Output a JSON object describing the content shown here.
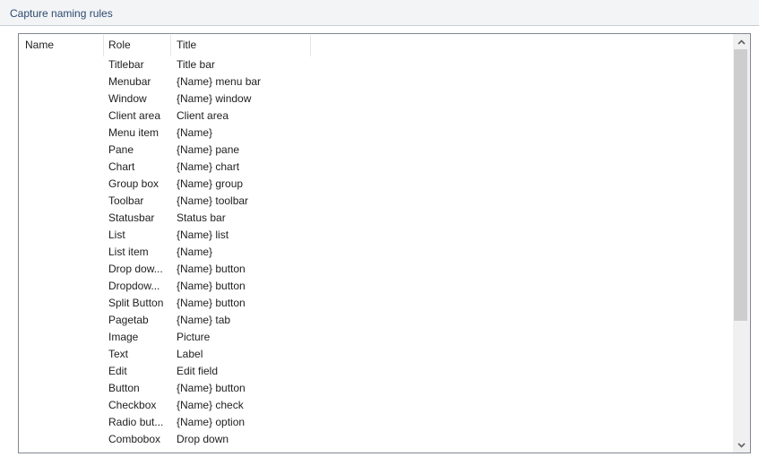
{
  "section": {
    "title": "Capture naming rules"
  },
  "list": {
    "columns": {
      "name": "Name",
      "role": "Role",
      "title": "Title"
    },
    "rows": [
      {
        "name": "",
        "role": "Titlebar",
        "title": "Title bar"
      },
      {
        "name": "",
        "role": "Menubar",
        "title": "{Name} menu bar"
      },
      {
        "name": "",
        "role": "Window",
        "title": "{Name} window"
      },
      {
        "name": "",
        "role": "Client area",
        "title": "Client area"
      },
      {
        "name": "",
        "role": "Menu item",
        "title": "{Name}"
      },
      {
        "name": "",
        "role": "Pane",
        "title": "{Name} pane"
      },
      {
        "name": "",
        "role": "Chart",
        "title": "{Name} chart"
      },
      {
        "name": "",
        "role": "Group box",
        "title": "{Name} group"
      },
      {
        "name": "",
        "role": "Toolbar",
        "title": "{Name} toolbar"
      },
      {
        "name": "",
        "role": "Statusbar",
        "title": "Status bar"
      },
      {
        "name": "",
        "role": "List",
        "title": "{Name} list"
      },
      {
        "name": "",
        "role": "List item",
        "title": "{Name}"
      },
      {
        "name": "",
        "role": "Drop dow...",
        "title": "{Name} button"
      },
      {
        "name": "",
        "role": "Dropdow...",
        "title": "{Name} button"
      },
      {
        "name": "",
        "role": "Split Button",
        "title": "{Name} button"
      },
      {
        "name": "",
        "role": "Pagetab",
        "title": "{Name} tab"
      },
      {
        "name": "",
        "role": "Image",
        "title": "Picture"
      },
      {
        "name": "",
        "role": "Text",
        "title": "Label"
      },
      {
        "name": "",
        "role": "Edit",
        "title": "Edit field"
      },
      {
        "name": "",
        "role": "Button",
        "title": "{Name} button"
      },
      {
        "name": "",
        "role": "Checkbox",
        "title": "{Name} check"
      },
      {
        "name": "",
        "role": "Radio but...",
        "title": "{Name} option"
      },
      {
        "name": "",
        "role": "Combobox",
        "title": "Drop down"
      }
    ]
  },
  "scrollbar": {
    "up_icon": "▲",
    "down_icon": "▼",
    "position_fraction": 0.0,
    "visible_fraction": 0.7
  }
}
